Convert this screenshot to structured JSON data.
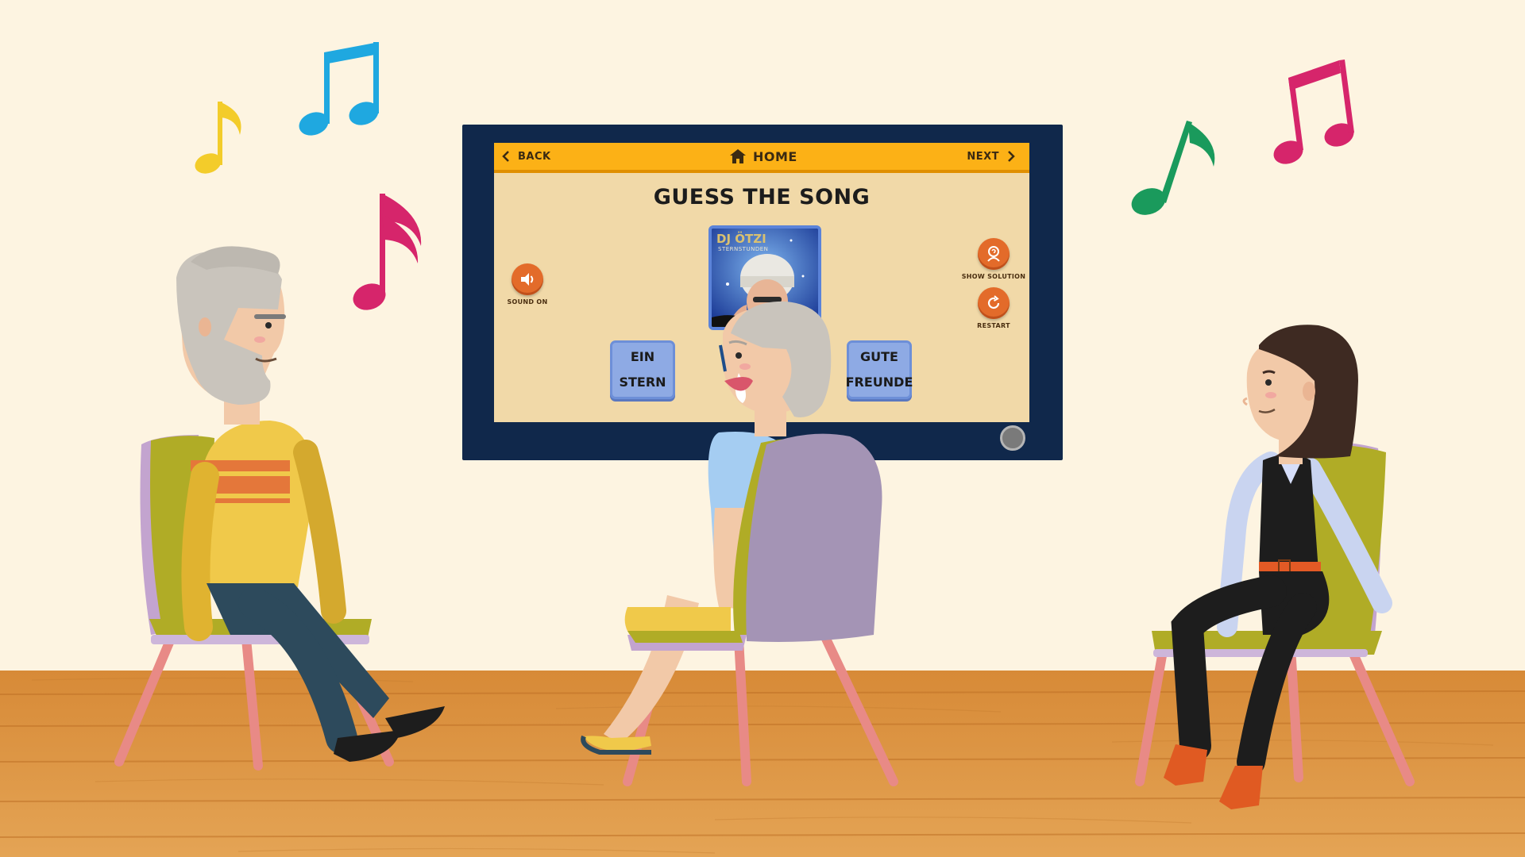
{
  "topbar": {
    "back_label": "BACK",
    "home_label": "HOME",
    "next_label": "NEXT"
  },
  "game": {
    "title": "GUESS THE SONG",
    "album_artist": "DJ ÖTZI",
    "album_title": "STERNSTUNDEN",
    "sound_label": "SOUND ON",
    "solution_label": "SHOW SOLUTION",
    "restart_label": "RESTART",
    "answers": [
      {
        "line1": "EIN",
        "line2": "STERN"
      },
      {
        "line1": "GUTE",
        "line2": "FREUNDE"
      }
    ]
  },
  "colors": {
    "wall": "#fdf4e1",
    "tv_frame": "#10284b",
    "screen_bg": "#f1d9a8",
    "topbar": "#fcb116",
    "round_button": "#e36b2a",
    "answer_button": "#8eaae4",
    "floor": "#d98e3c",
    "note_yellow": "#f3cc2a",
    "note_blue": "#1fa8e0",
    "note_magenta": "#d6256b",
    "note_green": "#1a9a5c"
  },
  "icons": {
    "back": "chevron-left-icon",
    "home": "house-icon",
    "next": "chevron-right-icon",
    "sound": "speaker-icon",
    "solution": "person-help-icon",
    "restart": "restart-icon"
  }
}
